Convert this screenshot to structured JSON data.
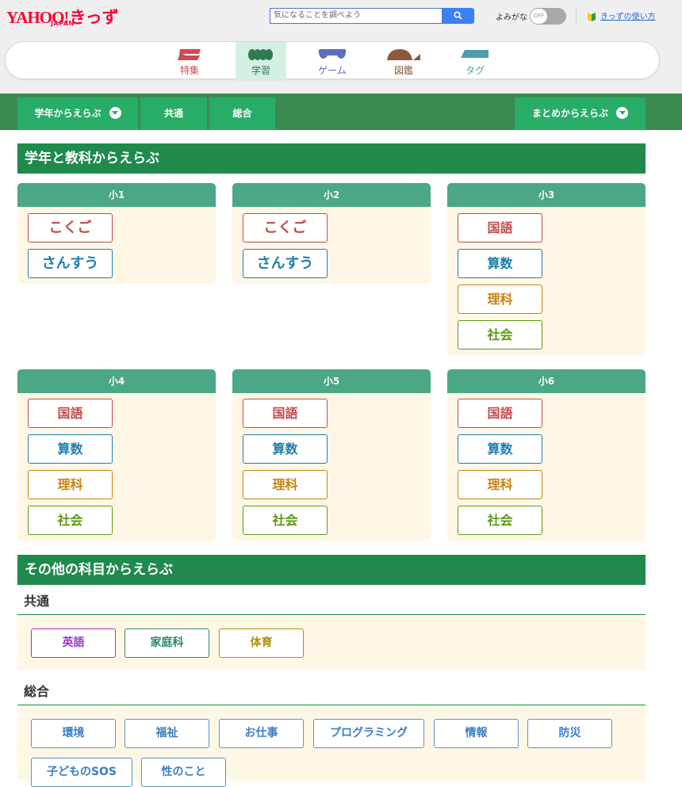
{
  "header": {
    "logo_yahoo": "YAHOO!",
    "logo_kids": "きっず",
    "logo_japan": "JAPAN",
    "search_placeholder": "気になることを調べよう",
    "yomigana_label": "よみがな",
    "toggle_state": "OFF",
    "guide_link": "きっずの使い方"
  },
  "nav": {
    "tabs": [
      {
        "label": "特集",
        "icon": "feature-icon",
        "color": "#d14b4b"
      },
      {
        "label": "学習",
        "icon": "study-icon",
        "color": "#2f7a50",
        "active": true
      },
      {
        "label": "ゲーム",
        "icon": "game-controller-icon",
        "color": "#5b6fc0"
      },
      {
        "label": "図鑑",
        "icon": "encyclopedia-icon",
        "color": "#8a5a3c"
      },
      {
        "label": "タグ",
        "icon": "tag-icon",
        "color": "#4aa0a6"
      }
    ]
  },
  "greenbar": {
    "grade_select": "学年からえらぶ",
    "common": "共通",
    "general": "総合",
    "summary_select": "まとめからえらぶ"
  },
  "grades_section": {
    "title": "学年と教科からえらぶ",
    "grades": [
      {
        "name": "小1",
        "subjects": [
          "こくご",
          "さんすう"
        ]
      },
      {
        "name": "小2",
        "subjects": [
          "こくご",
          "さんすう"
        ]
      },
      {
        "name": "小3",
        "subjects": [
          "国語",
          "算数",
          "理科",
          "社会"
        ]
      },
      {
        "name": "小4",
        "subjects": [
          "国語",
          "算数",
          "理科",
          "社会"
        ]
      },
      {
        "name": "小5",
        "subjects": [
          "国語",
          "算数",
          "理科",
          "社会"
        ]
      },
      {
        "name": "小6",
        "subjects": [
          "国語",
          "算数",
          "理科",
          "社会"
        ]
      }
    ]
  },
  "other_section": {
    "title": "その他の科目からえらぶ",
    "common": {
      "title": "共通",
      "items": [
        "英語",
        "家庭科",
        "体育"
      ]
    },
    "general": {
      "title": "総合",
      "items": [
        "環境",
        "福祉",
        "お仕事",
        "プログラミング",
        "情報",
        "防災",
        "子どものSOS",
        "性のこと"
      ]
    }
  },
  "colors": {
    "accent_green": "#1f8a4c",
    "grade_header": "#4aa884",
    "card_bg": "#fff7e5",
    "japanese": "#c44a4a",
    "math": "#1e7fae",
    "science": "#c98310",
    "social": "#5c9a14"
  }
}
